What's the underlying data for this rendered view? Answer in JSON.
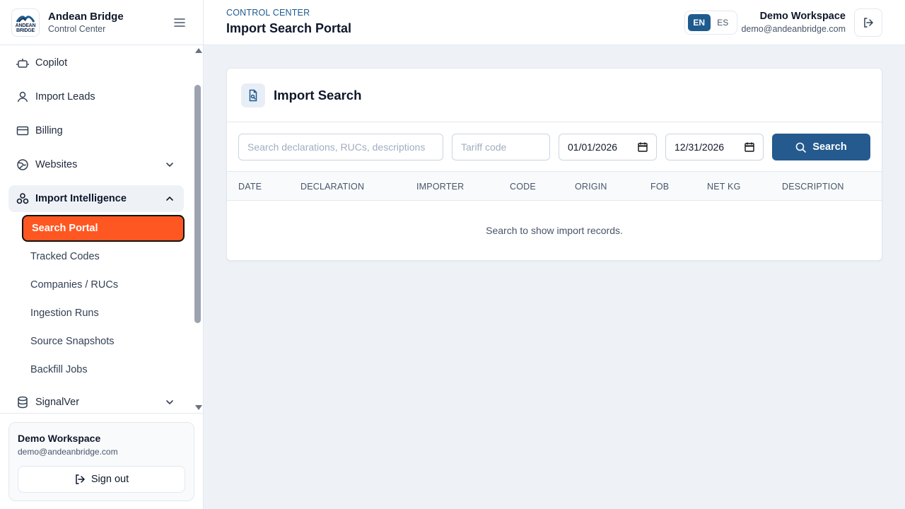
{
  "brand": {
    "name": "Andean Bridge",
    "subtitle": "Control Center",
    "logo_line1": "ANDEAN",
    "logo_line2": "BRIDGE"
  },
  "sidebar": {
    "items": [
      {
        "label": "Copilot",
        "icon": "bot-icon"
      },
      {
        "label": "Import Leads",
        "icon": "user-icon"
      },
      {
        "label": "Billing",
        "icon": "credit-card-icon"
      },
      {
        "label": "Websites",
        "icon": "globe-icon"
      },
      {
        "label": "Import Intelligence",
        "icon": "network-icon"
      },
      {
        "label": "SignalVer",
        "icon": "database-icon"
      }
    ],
    "sub_items": [
      {
        "label": "Search Portal",
        "active": true
      },
      {
        "label": "Tracked Codes"
      },
      {
        "label": "Companies / RUCs"
      },
      {
        "label": "Ingestion Runs"
      },
      {
        "label": "Source Snapshots"
      },
      {
        "label": "Backfill Jobs"
      }
    ],
    "footer": {
      "name": "Demo Workspace",
      "email": "demo@andeanbridge.com",
      "signout_label": "Sign out"
    }
  },
  "header": {
    "breadcrumb": "CONTROL CENTER",
    "title": "Import Search Portal",
    "lang_en": "EN",
    "lang_es": "ES",
    "workspace_name": "Demo Workspace",
    "workspace_email": "demo@andeanbridge.com"
  },
  "card": {
    "title": "Import Search",
    "search_placeholder": "Search declarations, RUCs, descriptions",
    "tariff_placeholder": "Tariff code",
    "date_from": "01/01/2026",
    "date_to": "12/31/2026",
    "search_label": "Search",
    "columns": [
      "DATE",
      "DECLARATION",
      "IMPORTER",
      "CODE",
      "ORIGIN",
      "FOB",
      "NET KG",
      "DESCRIPTION"
    ],
    "empty_message": "Search to show import records."
  },
  "colors": {
    "accent": "#245a8e",
    "active_nav": "#ff5722",
    "background": "#eef2f7"
  }
}
